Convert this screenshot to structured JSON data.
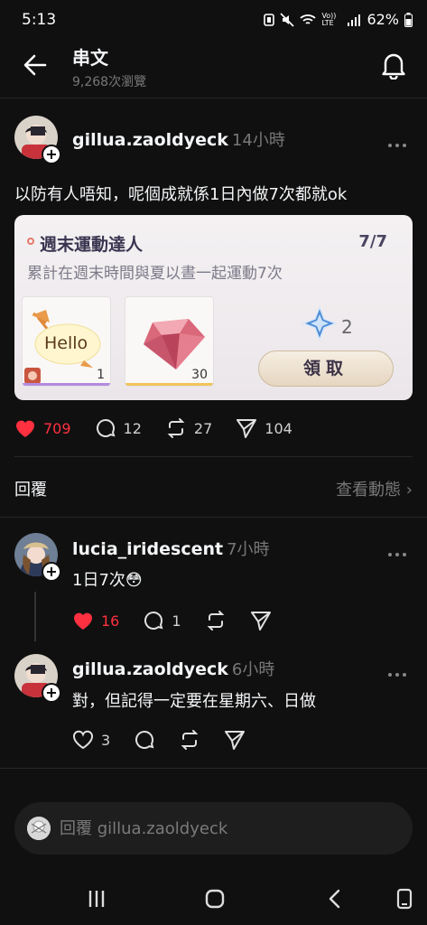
{
  "status_bar": {
    "time": "5:13",
    "battery": "62%",
    "signal_label": "Vo)) LTE"
  },
  "header": {
    "title": "串文",
    "views": "9,268次瀏覽"
  },
  "post": {
    "username": "gillua.zaoldyeck",
    "time": "14小時",
    "text": "以防有人唔知，呢個成就係1日內做7次都就ok",
    "card": {
      "title": "週末運動達人",
      "progress": "7/7",
      "description": "累計在週末時間與夏以晝一起運動7次",
      "rewards": [
        {
          "name": "Hello",
          "qty": "1"
        },
        {
          "name": "gem",
          "qty": "30"
        }
      ],
      "star_count": "2",
      "claim_label": "領取"
    },
    "likes": "709",
    "comments": "12",
    "reposts": "27",
    "shares": "104"
  },
  "replies_section": {
    "label": "回覆",
    "view_activity": "查看動態"
  },
  "comments": [
    {
      "username": "lucia_iridescent",
      "time": "7小時",
      "text": "1日7次😳",
      "likes": "16",
      "replies": "1"
    },
    {
      "username": "gillua.zaoldyeck",
      "time": "6小時",
      "text": "對，但記得一定要在星期六、日做",
      "likes": "3"
    }
  ],
  "reply_box": {
    "placeholder": "回覆 gillua.zaoldyeck"
  },
  "colors": {
    "background": "#101010",
    "like_red": "#ff3040",
    "muted": "#777777"
  }
}
